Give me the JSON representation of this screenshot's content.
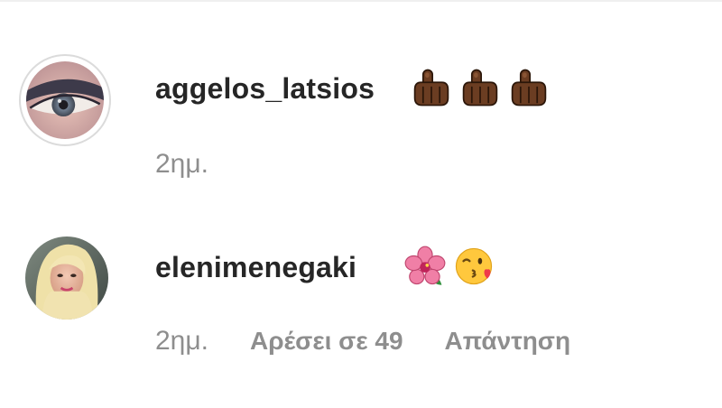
{
  "comments": [
    {
      "username": "aggelos_latsios",
      "time": "2ημ.",
      "emojis": [
        "hand-emoji",
        "hand-emoji",
        "hand-emoji"
      ]
    },
    {
      "username": "elenimenegaki",
      "time": "2ημ.",
      "likes_label": "Αρέσει σε 49",
      "reply_label": "Απάντηση",
      "emojis": [
        "hibiscus-emoji",
        "kissing-face-emoji"
      ]
    }
  ],
  "colors": {
    "text_primary": "#262626",
    "text_secondary": "#8e8e8e",
    "avatar_ring": "#dbdbdb"
  }
}
